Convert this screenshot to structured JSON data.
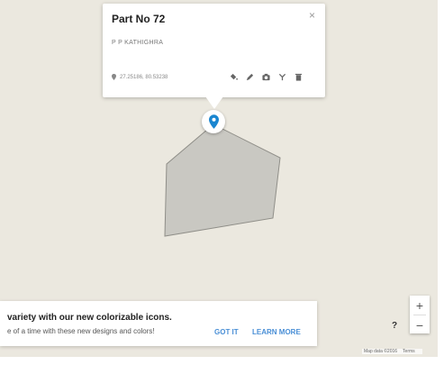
{
  "info_window": {
    "title": "Part No 72",
    "subtitle": "P P KATHIGHRA",
    "coordinates": "27.25186, 80.53238",
    "close_symbol": "×",
    "tool_icons": [
      "paint-bucket-icon",
      "pencil-icon",
      "camera-icon",
      "route-icon",
      "trash-icon"
    ]
  },
  "marker": {
    "color": "#1a86d0"
  },
  "polygon": {
    "fill": "#c9c8c2",
    "stroke": "#8f8e88"
  },
  "promo": {
    "title": "variety with our new colorizable icons.",
    "text": "e of a time with these new designs and colors!",
    "got_it": "GOT IT",
    "learn_more": "LEARN MORE",
    "button_color": "#4a8fd6"
  },
  "controls": {
    "zoom_in": "+",
    "zoom_out": "−",
    "help": "?"
  },
  "attribution": {
    "map_data": "Map data ©2016",
    "terms": "Terms"
  },
  "colors": {
    "map_background": "#ebe8df"
  }
}
